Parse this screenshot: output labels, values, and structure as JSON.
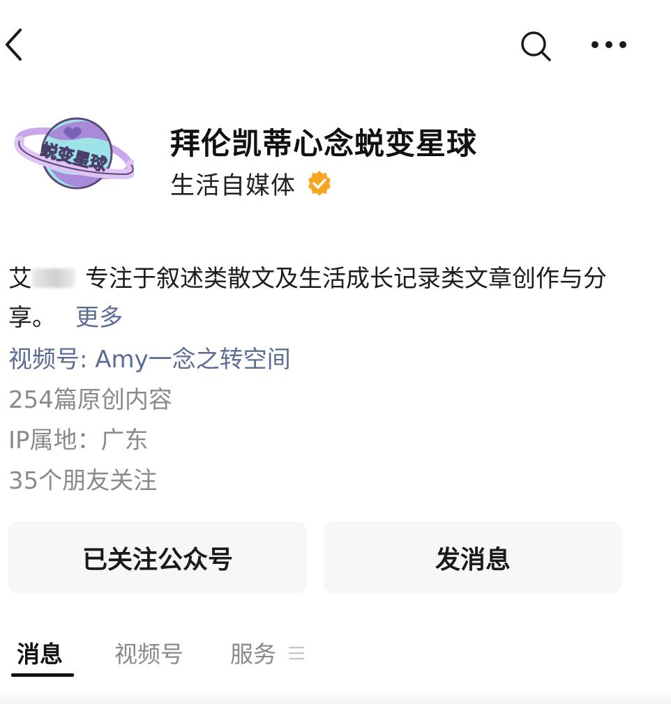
{
  "topbar": {
    "back_icon": "chevron-left-icon",
    "search_icon": "search-icon",
    "more_icon": "more-horizontal-icon"
  },
  "profile": {
    "avatar_text": "蜕变星球",
    "name": "拜伦凯蒂心念蜕变星球",
    "type": "生活自媒体",
    "verified_icon": "verified-badge-icon",
    "verified_color": "#f5a623"
  },
  "bio": {
    "prefix": "艾",
    "text": "专注于叙述类散文及生活成长记录类文章创作与分享。",
    "more_label": "更多"
  },
  "info": {
    "channel": "视频号: Amy一念之转空间",
    "original_count": "254篇原创内容",
    "ip_location": "IP属地：广东",
    "friends_following": "35个朋友关注"
  },
  "actions": {
    "followed_label": "已关注公众号",
    "message_label": "发消息"
  },
  "tabs": [
    {
      "label": "消息",
      "active": true
    },
    {
      "label": "视频号",
      "active": false
    },
    {
      "label": "服务",
      "active": false
    }
  ],
  "colors": {
    "link": "#5b6c95",
    "secondary_text": "#8a8a8a",
    "button_bg": "#f7f7f7"
  }
}
